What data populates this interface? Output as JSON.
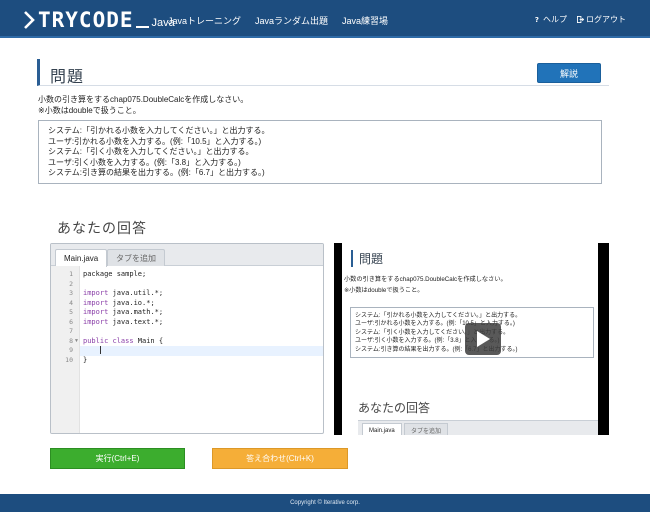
{
  "header": {
    "logo_text": "TRYCODE",
    "logo_sub": "Java",
    "nav": [
      "Javaトレーニング",
      "Javaランダム出題",
      "Java練習場"
    ],
    "help": "ヘルプ",
    "logout": "ログアウト"
  },
  "problem": {
    "title": "問題",
    "explain_button": "解説",
    "desc_line1": "小数の引き算をするchap075.DoubleCalcを作成しなさい。",
    "desc_line2": "※小数はdoubleで扱うこと。",
    "spec": [
      "システム:「引かれる小数を入力してください。」と出力する。",
      "ユーザ:引かれる小数を入力する。(例:「10.5」と入力する。)",
      "システム:「引く小数を入力してください。」と出力する。",
      "ユーザ:引く小数を入力する。(例:「3.8」と入力する。)",
      "システム:引き算の結果を出力する。(例:「6.7」と出力する。)"
    ]
  },
  "answer": {
    "title": "あなたの回答",
    "tabs": {
      "active": "Main.java",
      "add": "タブを追加"
    },
    "code": [
      {
        "n": "1",
        "pre": "package sample;",
        "kw": ""
      },
      {
        "n": "2",
        "pre": "",
        "kw": ""
      },
      {
        "n": "3",
        "pre": "import java.util.*;",
        "kw": "import"
      },
      {
        "n": "4",
        "pre": "import java.io.*;",
        "kw": "import"
      },
      {
        "n": "5",
        "pre": "import java.math.*;",
        "kw": "import"
      },
      {
        "n": "6",
        "pre": "import java.text.*;",
        "kw": "import"
      },
      {
        "n": "7",
        "pre": "",
        "kw": ""
      },
      {
        "n": "8",
        "pre": "public class Main {",
        "kw": "public class"
      },
      {
        "n": "9",
        "pre": "",
        "kw": ""
      },
      {
        "n": "10",
        "pre": "}",
        "kw": ""
      }
    ]
  },
  "video": {
    "title": "問題",
    "desc_line1": "小数の引き算をするchap075.DoubleCalcを作成しなさい。",
    "desc_line2": "※小数はdoubleで扱うこと。",
    "spec": [
      "システム:「引かれる小数を入力してください。」と出力する。",
      "ユーザ:引かれる小数を入力する。(例:「10.5」と入力する。)",
      "システム:「引く小数を入力してください。」と出力する。",
      "ユーザ:引く小数を入力する。(例:「3.8」と入力する。)",
      "システム:引き算の結果を出力する。(例:「6.7」と出力する。)"
    ],
    "answer_title": "あなたの回答",
    "tab_active": "Main.java",
    "tab_add": "タブを追加"
  },
  "buttons": {
    "run": "実行(Ctrl+E)",
    "check": "答え合わせ(Ctrl+K)"
  },
  "footer": "Copyright © Iterative corp.",
  "colors": {
    "header": "#1d4d7f",
    "explain_button": "#2173b9",
    "run_button": "#3cad2e",
    "check_button": "#f5a623"
  }
}
